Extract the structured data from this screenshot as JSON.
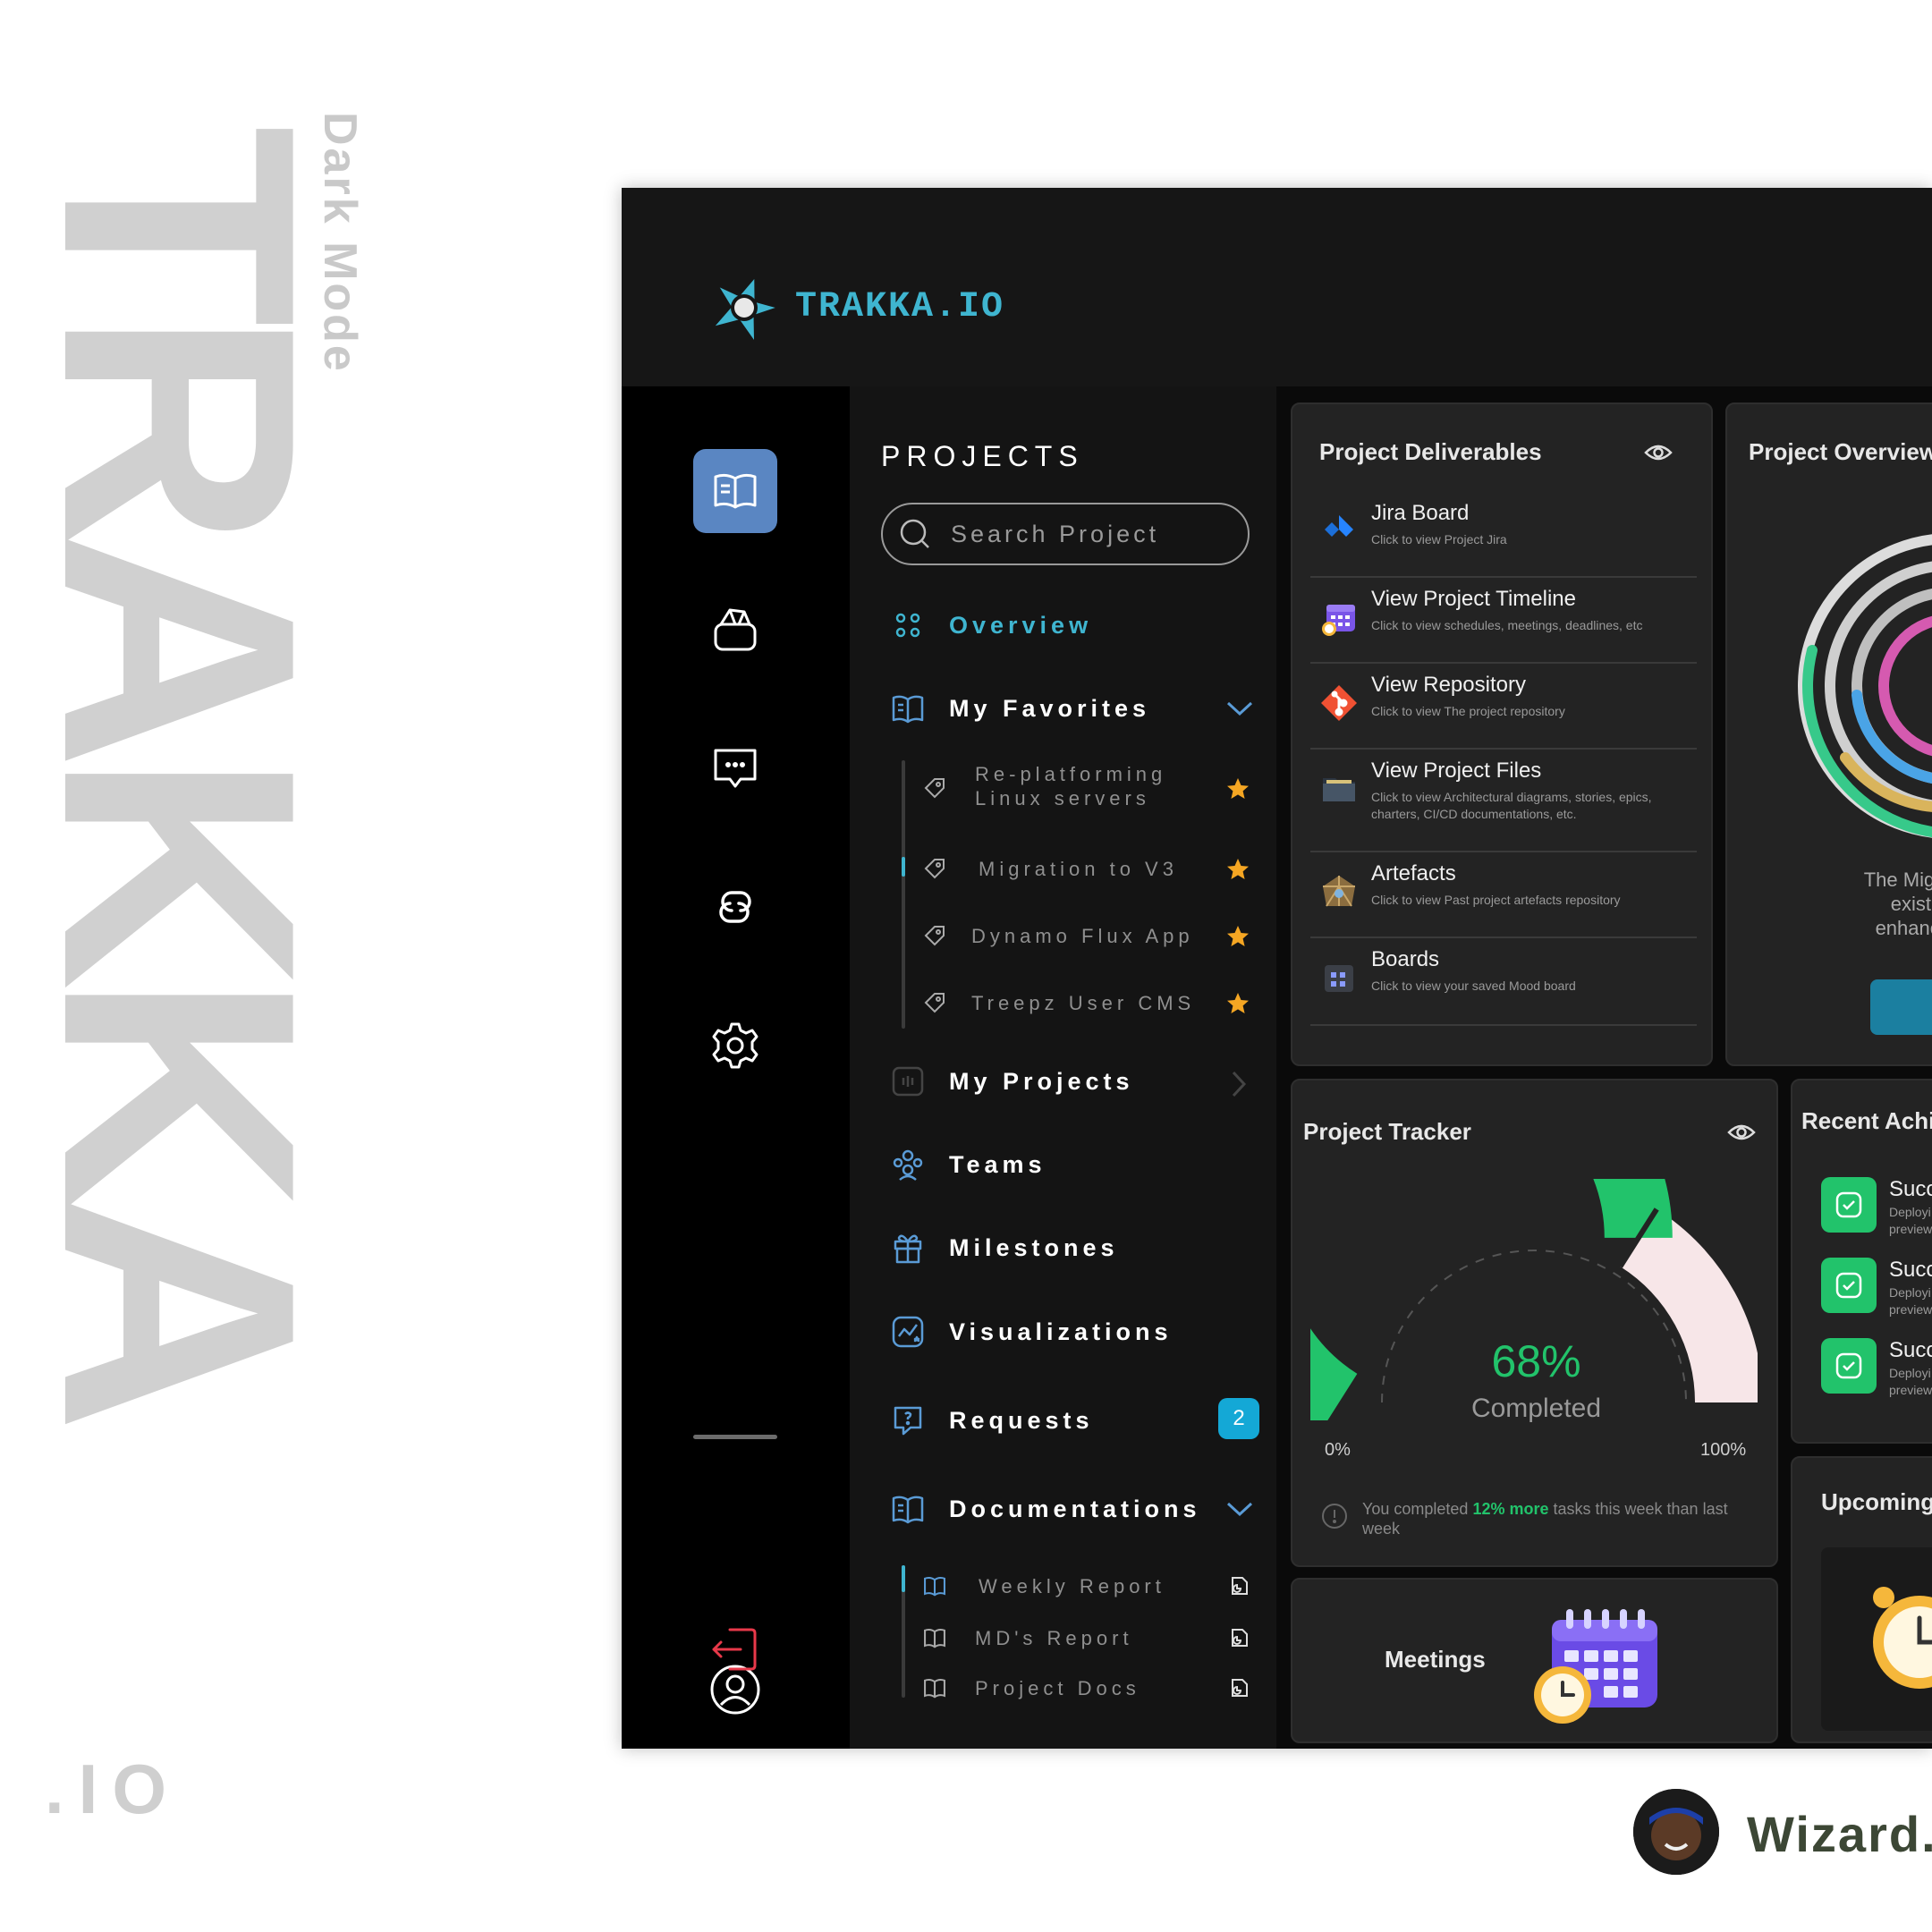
{
  "brand": {
    "vertical_title": "TRAKKA",
    "mode_label": "Dark Mode",
    "suffix": ".IO",
    "logo_text": "TRAKKA.IO"
  },
  "rail": {
    "icons": [
      "book-icon",
      "cube-icon",
      "chat-icon",
      "link-icon",
      "gear-icon",
      "user-icon",
      "logout-icon"
    ],
    "active": "book-icon"
  },
  "panel": {
    "title": "PROJECTS",
    "search_placeholder": "Search Project",
    "overview": "Overview",
    "favorites": {
      "label": "My Favorites",
      "items": [
        {
          "label": "Re-platforming Linux servers"
        },
        {
          "label": "Migration to V3"
        },
        {
          "label": "Dynamo Flux App"
        },
        {
          "label": "Treepz User CMS"
        }
      ]
    },
    "my_projects": "My Projects",
    "teams": "Teams",
    "milestones": "Milestones",
    "visualizations": "Visualizations",
    "requests": {
      "label": "Requests",
      "badge": "2"
    },
    "documentations": {
      "label": "Documentations",
      "items": [
        {
          "label": "Weekly Report"
        },
        {
          "label": "MD's Report"
        },
        {
          "label": "Project Docs"
        }
      ]
    }
  },
  "deliverables": {
    "title": "Project Deliverables",
    "items": [
      {
        "title": "Jira Board",
        "subtitle": "Click to view Project Jira",
        "icon": "jira-icon"
      },
      {
        "title": "View Project Timeline",
        "subtitle": "Click to view schedules, meetings, deadlines, etc",
        "icon": "calendar-icon"
      },
      {
        "title": "View Repository",
        "subtitle": "Click to view The project repository",
        "icon": "git-icon"
      },
      {
        "title": "View Project Files",
        "subtitle": "Click to view Architectural diagrams, stories, epics, charters, CI/CD documentations, etc.",
        "icon": "folder-icon"
      },
      {
        "title": "Artefacts",
        "subtitle": "Click to view Past project artefacts repository",
        "icon": "artefact-icon"
      },
      {
        "title": "Boards",
        "subtitle": "Click to view your saved Mood board",
        "icon": "board-icon"
      }
    ]
  },
  "overview_card": {
    "title": "Project Overview",
    "desc_lines": [
      "The Migration",
      "existing",
      "enhanced f"
    ]
  },
  "tracker": {
    "title": "Project Tracker",
    "percent": 68,
    "percent_label": "68%",
    "completed_label": "Completed",
    "min_label": "0%",
    "max_label": "100%",
    "note_prefix": "You completed ",
    "note_highlight": "12% more",
    "note_suffix": " tasks this week than last week",
    "colors": {
      "done": "#22c36b",
      "rest": "#f7e6e8"
    }
  },
  "achievements": {
    "title": "Recent Achievements",
    "items": [
      {
        "title": "Succ",
        "line1": "Deployi",
        "line2": "preview"
      },
      {
        "title": "Succ",
        "line1": "Deployi",
        "line2": "preview"
      },
      {
        "title": "Succ",
        "line1": "Deployi",
        "line2": "preview"
      }
    ]
  },
  "meetings": {
    "title": "Meetings"
  },
  "upcoming": {
    "title": "Upcoming"
  },
  "footer": {
    "name": "Wizard.f"
  }
}
